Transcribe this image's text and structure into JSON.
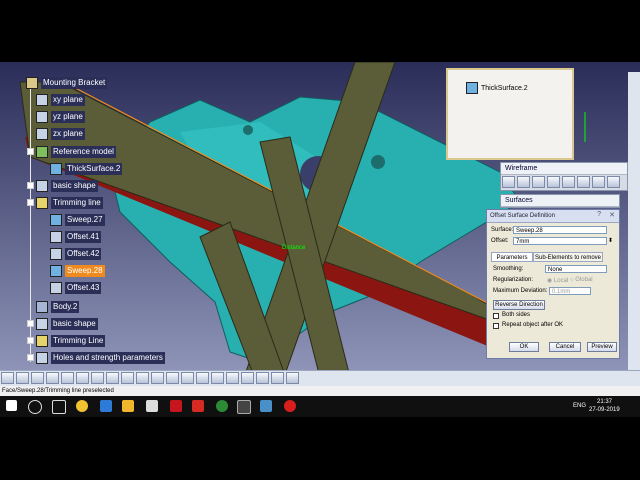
{
  "tree": {
    "root": "Mounting Bracket",
    "items": [
      {
        "label": "xy plane",
        "highlight": false
      },
      {
        "label": "yz plane",
        "highlight": false
      },
      {
        "label": "zx plane",
        "highlight": false
      },
      {
        "label": "Reference model",
        "highlight": false
      },
      {
        "label": "ThickSurface.2",
        "highlight": false
      },
      {
        "label": "basic shape",
        "highlight": false
      },
      {
        "label": "Trimming line",
        "highlight": false
      },
      {
        "label": "Sweep.27",
        "highlight": false
      },
      {
        "label": "Offset.41",
        "highlight": false
      },
      {
        "label": "Offset.42",
        "highlight": false
      },
      {
        "label": "Sweep.28",
        "highlight": true
      },
      {
        "label": "Offset.43",
        "highlight": false
      },
      {
        "label": "Body.2",
        "highlight": false
      },
      {
        "label": "basic shape",
        "highlight": false
      },
      {
        "label": "Trimming Line",
        "highlight": false
      },
      {
        "label": "Holes and strength parameters",
        "highlight": false
      }
    ]
  },
  "preview_window": {
    "label": "ThickSurface.2"
  },
  "toolbars": {
    "wireframe": "Wireframe",
    "surfaces": "Surfaces"
  },
  "viewport_label": "Distance",
  "dialog": {
    "title": "Offset Surface Definition",
    "surface_label": "Surface:",
    "surface_value": "Sweep.28",
    "offset_label": "Offset:",
    "offset_value": "7mm",
    "tab_parameters": "Parameters",
    "tab_subelements": "Sub-Elements to remove",
    "smoothing_label": "Smoothing:",
    "smoothing_value": "None",
    "regularization_label": "Regularization:",
    "reg_local": "Local",
    "reg_global": "Global",
    "max_deviation_label": "Maximum Deviation:",
    "max_deviation_value": "0.1mm",
    "reverse_button": "Reverse Direction",
    "both_sides": "Both sides",
    "repeat_object": "Repeat object after OK",
    "ok": "OK",
    "cancel": "Cancel",
    "preview": "Preview"
  },
  "status": {
    "text": "Face/Sweep.28/Trimming line preselected"
  },
  "taskbar": {
    "lang": "ENG",
    "time": "21:37",
    "date": "27-09-2019"
  },
  "colors": {
    "background_top": "#2b2f58",
    "part_cyan": "#27b1b1",
    "surface_olive": "#565936",
    "surface_red": "#8b1510",
    "highlight_orange": "#f08a1e"
  }
}
